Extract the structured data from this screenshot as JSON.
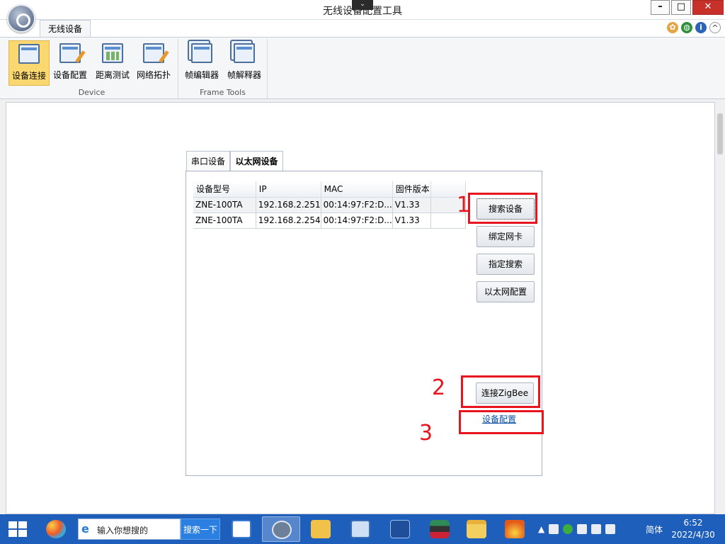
{
  "window": {
    "title": "无线设备配置工具"
  },
  "ribbon": {
    "tab": "无线设备",
    "groups": {
      "device": {
        "label": "Device",
        "buttons": [
          {
            "label": "设备连接",
            "icon": "device-link-icon",
            "active": true
          },
          {
            "label": "设备配置",
            "icon": "device-config-icon"
          },
          {
            "label": "距离测试",
            "icon": "distance-test-icon"
          },
          {
            "label": "网络拓扑",
            "icon": "network-topology-icon"
          }
        ]
      },
      "frame": {
        "label": "Frame Tools",
        "buttons": [
          {
            "label": "帧编辑器",
            "icon": "frame-editor-icon"
          },
          {
            "label": "帧解释器",
            "icon": "frame-interpreter-icon"
          }
        ]
      }
    }
  },
  "panel": {
    "tabs": [
      "串口设备",
      "以太网设备"
    ],
    "active_tab": "以太网设备",
    "table": {
      "headers": [
        "设备型号",
        "IP",
        "MAC",
        "固件版本",
        ""
      ],
      "rows": [
        [
          "ZNE-100TA",
          "192.168.2.251",
          "00:14:97:F2:D...",
          "V1.33",
          ""
        ],
        [
          "ZNE-100TA",
          "192.168.2.254",
          "00:14:97:F2:D...",
          "V1.33",
          ""
        ]
      ]
    },
    "buttons": {
      "search": "搜索设备",
      "bind_nic": "绑定网卡",
      "specified_search": "指定搜索",
      "ethernet_config": "以太网配置",
      "connect_zigbee": "连接ZigBee"
    },
    "link": "设备配置"
  },
  "annotations": [
    "1",
    "2",
    "3"
  ],
  "taskbar": {
    "search_placeholder": "输入你想搜的",
    "search_button": "搜索一下",
    "lang": "简体",
    "time": "6:52",
    "date": "2022/4/30"
  },
  "colors": {
    "accent": "#1e5fbc",
    "annotation": "#e8141e",
    "active_ribbon": "#fbd86f"
  }
}
